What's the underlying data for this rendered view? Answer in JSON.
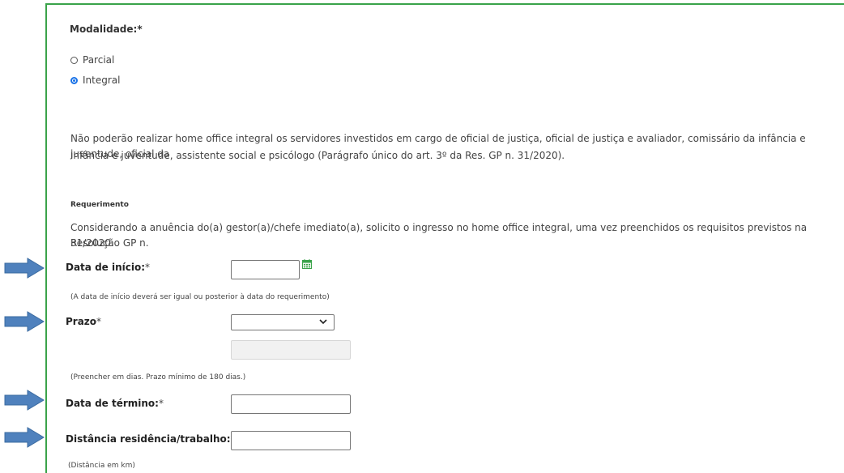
{
  "modalidade": {
    "label": "Modalidade:*",
    "options": [
      {
        "label": "Parcial",
        "checked": false
      },
      {
        "label": "Integral",
        "checked": true
      }
    ]
  },
  "notice": {
    "line1": "Não poderão realizar home office integral os servidores investidos em cargo de oficial de justiça, oficial de justiça e avaliador, comissário da infância e juventude, oficial da",
    "line2": "infância e juventude, assistente social e psicólogo (Parágrafo único do art. 3º da Res. GP n. 31/2020)."
  },
  "requerimento": {
    "title": "Requerimento",
    "text_line1": "Considerando a anuência do(a) gestor(a)/chefe imediato(a), solicito o ingresso no home office integral, uma vez preenchidos os requisitos previstos na Resolução GP n.",
    "text_line2": "31/2020."
  },
  "fields": {
    "data_inicio": {
      "label": "Data de início:",
      "required": "*",
      "value": "",
      "hint": "(A data de início deverá ser igual ou posterior à data do requerimento)"
    },
    "prazo": {
      "label": "Prazo",
      "required": "*",
      "selected": "",
      "extra_value": "",
      "hint": "(Preencher em dias. Prazo mínimo de 180 dias.)"
    },
    "data_termino": {
      "label": "Data de término:",
      "required": "*",
      "value": ""
    },
    "distancia": {
      "label": "Distância residência/trabalho:",
      "required": "*",
      "value": "",
      "hint": "(Distância em km)"
    }
  },
  "colors": {
    "panel_border": "#3aa34a",
    "arrow_fill": "#4f81bd",
    "arrow_stroke": "#3a6aa0",
    "radio_accent": "#1a73e8",
    "calendar_icon": "#3aa34a"
  },
  "icons": {
    "calendar": "calendar-icon",
    "dropdown": "chevron-down-icon",
    "annotation": "arrow-right-icon"
  }
}
